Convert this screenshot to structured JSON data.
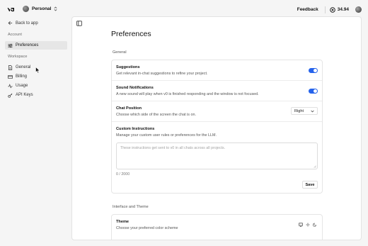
{
  "topbar": {
    "workspace_name": "Personal",
    "feedback_label": "Feedback",
    "credits": "34.94"
  },
  "sidebar": {
    "back_label": "Back to app",
    "account_label": "Account",
    "preferences_label": "Preferences",
    "workspace_label": "Workspace",
    "items": [
      {
        "label": "General",
        "icon": "document-icon"
      },
      {
        "label": "Billing",
        "icon": "credit-card-icon"
      },
      {
        "label": "Usage",
        "icon": "activity-icon"
      },
      {
        "label": "API Keys",
        "icon": "key-icon"
      }
    ]
  },
  "main": {
    "title": "Preferences",
    "general_label": "General",
    "suggestions": {
      "title": "Suggestions",
      "desc": "Get relevant in-chat suggestions to refine your project.",
      "enabled": true
    },
    "sound": {
      "title": "Sound Notifications",
      "desc": "A new sound will play when v0 is finished responding and the window is not focused.",
      "enabled": true
    },
    "chat_position": {
      "title": "Chat Position",
      "desc": "Choose which side of the screen the chat is on.",
      "value": "Right"
    },
    "custom_instructions": {
      "title": "Custom Instructions",
      "desc": "Manage your custom user rules or preferences for the LLM.",
      "placeholder": "These instructions get sent to v0 in all chats across all projects.",
      "count": "0 / 2000",
      "save_label": "Save"
    },
    "interface_label": "Interface and Theme",
    "theme": {
      "title": "Theme",
      "desc": "Choose your preferred color scheme",
      "options": [
        "monitor-icon",
        "sun-icon",
        "moon-icon"
      ]
    }
  },
  "colors": {
    "accent": "#2563eb",
    "background": "#f5f5f5",
    "panel": "#ffffff"
  }
}
